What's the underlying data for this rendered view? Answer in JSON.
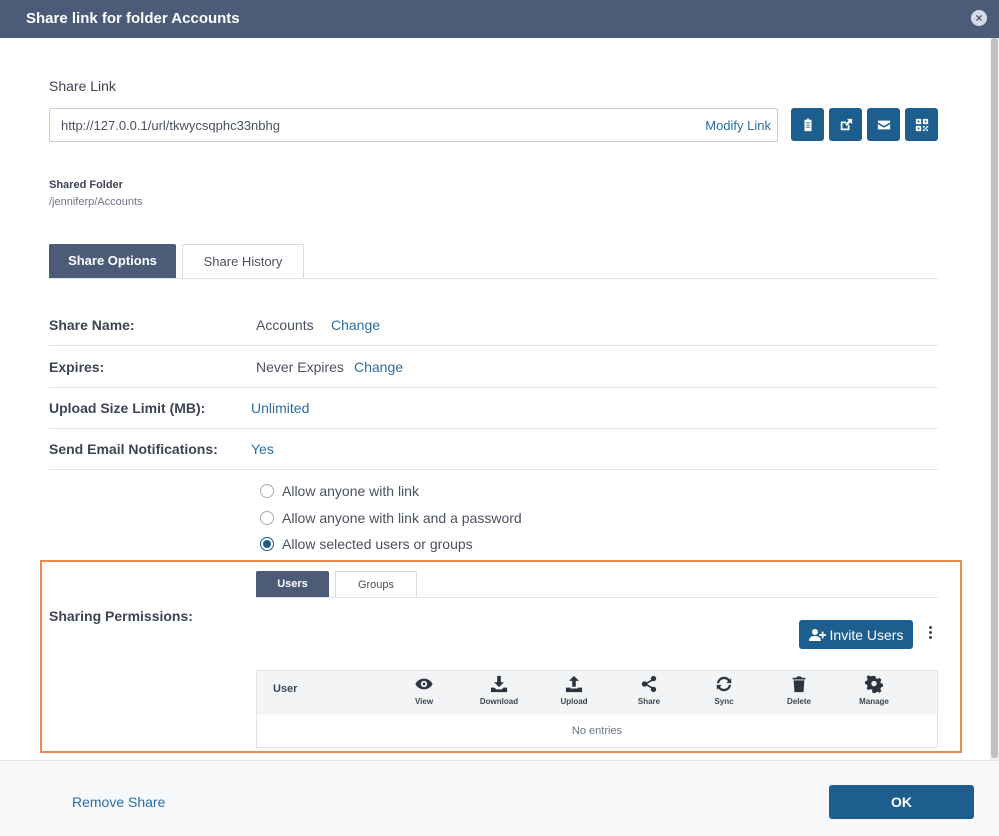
{
  "dialog": {
    "title": "Share link for folder Accounts",
    "close_icon": "×"
  },
  "share_link": {
    "label": "Share Link",
    "url": "http://127.0.0.1/url/tkwycsqphc33nbhg",
    "modify_label": "Modify Link",
    "buttons": [
      "clipboard-icon",
      "external-link-icon",
      "email-icon",
      "qrcode-icon"
    ]
  },
  "shared_folder": {
    "label": "Shared Folder",
    "path": "/jenniferp/Accounts"
  },
  "tabs": [
    {
      "label": "Share Options",
      "active": true
    },
    {
      "label": "Share History",
      "active": false
    }
  ],
  "options": {
    "share_name": {
      "label": "Share Name:",
      "value": "Accounts",
      "action": "Change"
    },
    "expires": {
      "label": "Expires:",
      "value": "Never Expires",
      "action": "Change"
    },
    "upload_limit": {
      "label": "Upload Size Limit (MB):",
      "value": "Unlimited"
    },
    "email_notifications": {
      "label": "Send Email Notifications:",
      "value": "Yes"
    }
  },
  "access": {
    "options": [
      {
        "label": "Allow anyone with link",
        "checked": false
      },
      {
        "label": "Allow anyone with link and a password",
        "checked": false
      },
      {
        "label": "Allow selected users or groups",
        "checked": true
      }
    ]
  },
  "permissions": {
    "label": "Sharing Permissions:",
    "subtabs": [
      {
        "label": "Users",
        "active": true
      },
      {
        "label": "Groups",
        "active": false
      }
    ],
    "invite_label": "Invite Users",
    "table": {
      "user_header": "User",
      "columns": [
        {
          "label": "View",
          "icon": "eye-icon"
        },
        {
          "label": "Download",
          "icon": "download-icon"
        },
        {
          "label": "Upload",
          "icon": "upload-icon"
        },
        {
          "label": "Share",
          "icon": "share-icon"
        },
        {
          "label": "Sync",
          "icon": "sync-icon"
        },
        {
          "label": "Delete",
          "icon": "trash-icon"
        },
        {
          "label": "Manage",
          "icon": "gear-icon"
        }
      ],
      "empty_text": "No entries"
    }
  },
  "footer": {
    "remove_label": "Remove Share",
    "ok_label": "OK"
  },
  "colors": {
    "header": "#4b5b78",
    "primary": "#1d5e8f",
    "link": "#2b6ea3",
    "highlight": "#f08a4b"
  }
}
